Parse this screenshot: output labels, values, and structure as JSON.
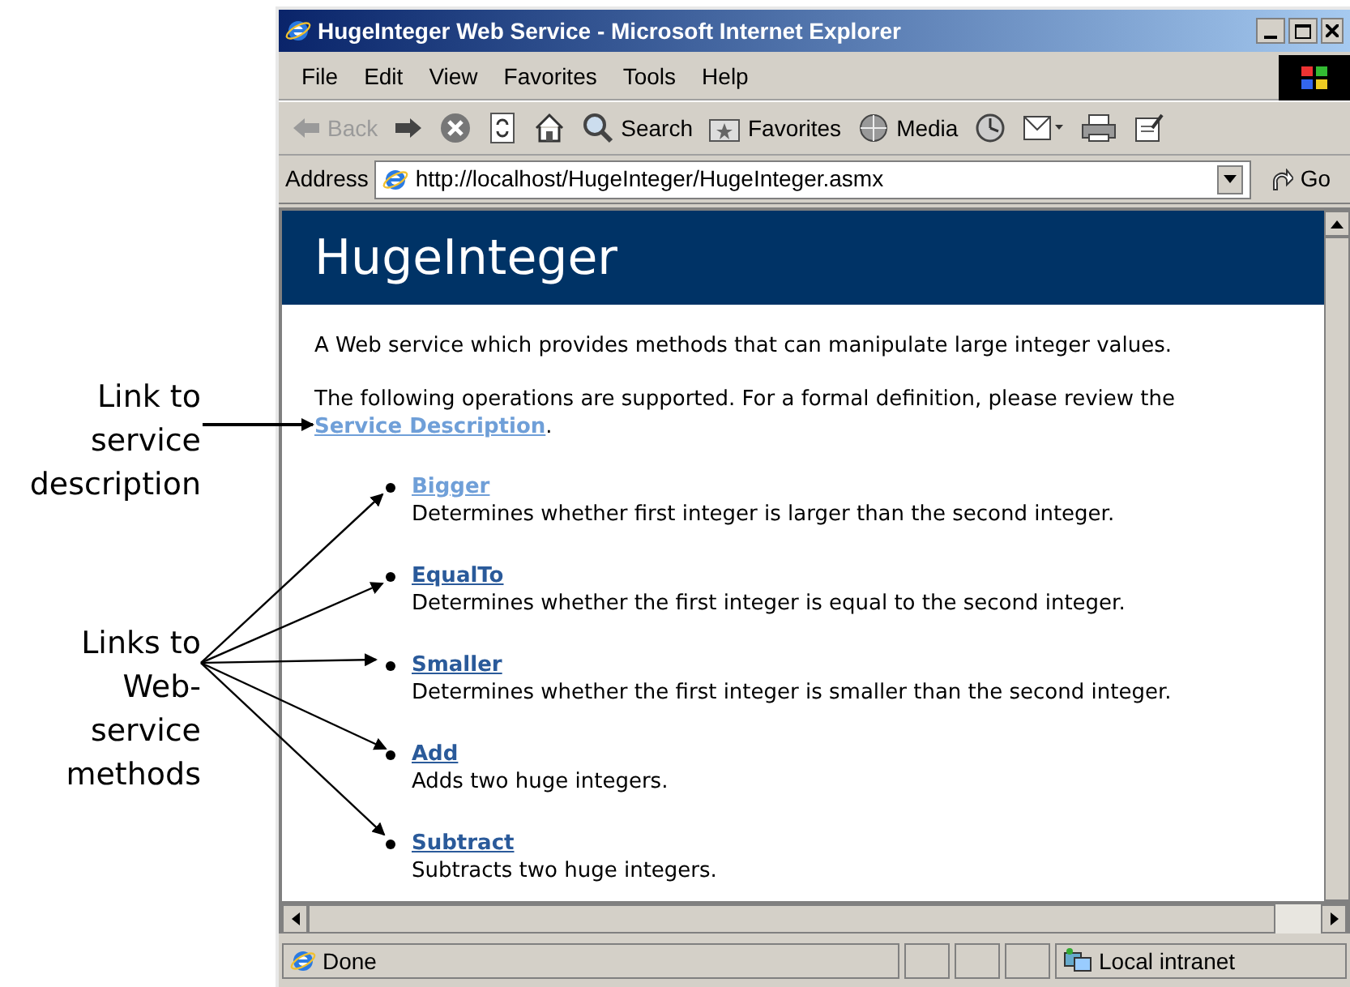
{
  "callouts": [
    {
      "text": "Link to service description"
    },
    {
      "text": "Links to Web-service methods"
    }
  ],
  "window": {
    "title": "HugeInteger Web Service - Microsoft Internet Explorer"
  },
  "menu": [
    "File",
    "Edit",
    "View",
    "Favorites",
    "Tools",
    "Help"
  ],
  "toolbar": [
    {
      "kind": "back",
      "label": "Back",
      "disabled": true
    },
    {
      "kind": "forward",
      "disabled": false
    },
    {
      "kind": "stop"
    },
    {
      "kind": "refresh"
    },
    {
      "kind": "home"
    },
    {
      "kind": "search",
      "label": "Search"
    },
    {
      "kind": "favorites",
      "label": "Favorites"
    },
    {
      "kind": "media",
      "label": "Media"
    },
    {
      "kind": "history"
    },
    {
      "kind": "mail"
    },
    {
      "kind": "print"
    },
    {
      "kind": "edit"
    }
  ],
  "address": {
    "label": "Address",
    "value": "http://localhost/HugeInteger/HugeInteger.asmx",
    "go": "Go"
  },
  "page": {
    "heading": "HugeInteger",
    "intro": "A Web service which provides methods that can manipulate large integer values.",
    "operations_text": "The following operations are supported. For a formal definition, please review the",
    "service_link": {
      "text": "Service Description",
      "visited": true
    },
    "period": ".",
    "methods": [
      {
        "name": "Bigger",
        "visited": true,
        "description": "Determines whether first integer is larger than the second integer."
      },
      {
        "name": "EqualTo",
        "visited": false,
        "description": "Determines whether the first integer is equal to the second integer."
      },
      {
        "name": "Smaller",
        "visited": false,
        "description": "Determines whether the first integer is smaller than the second integer."
      },
      {
        "name": "Add",
        "visited": false,
        "description": "Adds two huge integers."
      },
      {
        "name": "Subtract",
        "visited": false,
        "description": "Subtracts two huge integers."
      }
    ]
  },
  "status_bar": {
    "text": "Done",
    "zone": "Local intranet"
  }
}
